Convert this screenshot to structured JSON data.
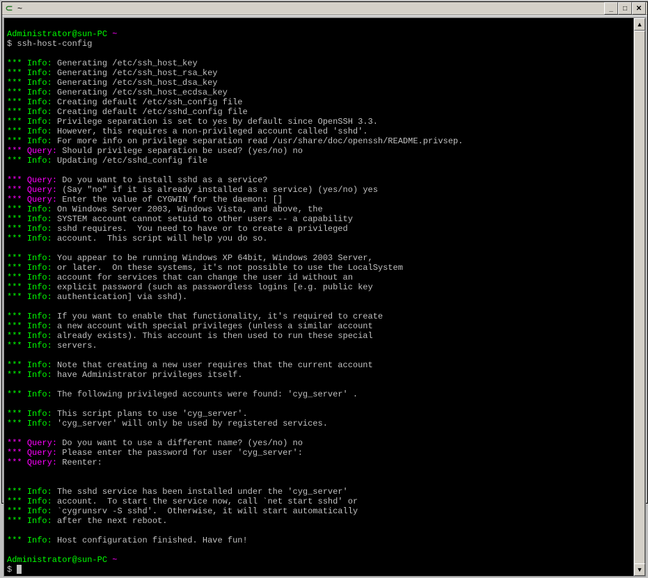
{
  "window": {
    "title": "~"
  },
  "prompt": {
    "user_host": "Administrator@sun-PC",
    "path": "~",
    "symbol": "$"
  },
  "command": "ssh-host-config",
  "stars": "***",
  "labels": {
    "info": "Info:",
    "query": "Query:"
  },
  "lines": [
    "Generating /etc/ssh_host_key",
    "Generating /etc/ssh_host_rsa_key",
    "Generating /etc/ssh_host_dsa_key",
    "Generating /etc/ssh_host_ecdsa_key",
    "Creating default /etc/ssh_config file",
    "Creating default /etc/sshd_config file",
    "Privilege separation is set to yes by default since OpenSSH 3.3.",
    "However, this requires a non-privileged account called 'sshd'.",
    "For more info on privilege separation read /usr/share/doc/openssh/README.privsep."
  ],
  "q1": {
    "text": "Should privilege separation be used? (yes/no)",
    "ans": "no"
  },
  "l10": "Updating /etc/sshd_config file",
  "q2": {
    "text": "Do you want to install sshd as a service?"
  },
  "q3": {
    "text": "(Say \"no\" if it is already installed as a service) (yes/no)",
    "ans": "yes"
  },
  "q4": {
    "text": "Enter the value of CYGWIN for the daemon: []"
  },
  "block2": [
    "On Windows Server 2003, Windows Vista, and above, the",
    "SYSTEM account cannot setuid to other users -- a capability",
    "sshd requires.  You need to have or to create a privileged",
    "account.  This script will help you do so."
  ],
  "block3": [
    "You appear to be running Windows XP 64bit, Windows 2003 Server,",
    "or later.  On these systems, it's not possible to use the LocalSystem",
    "account for services that can change the user id without an",
    "explicit password (such as passwordless logins [e.g. public key",
    "authentication] via sshd)."
  ],
  "block4": [
    "If you want to enable that functionality, it's required to create",
    "a new account with special privileges (unless a similar account",
    "already exists). This account is then used to run these special",
    "servers."
  ],
  "block5": [
    "Note that creating a new user requires that the current account",
    "have Administrator privileges itself."
  ],
  "l_found": "The following privileged accounts were found: 'cyg_server' .",
  "block6": [
    "This script plans to use 'cyg_server'.",
    "'cyg_server' will only be used by registered services."
  ],
  "q5": {
    "text": "Do you want to use a different name? (yes/no)",
    "ans": "no"
  },
  "q6": {
    "text": "Please enter the password for user 'cyg_server':"
  },
  "q7": {
    "text": "Reenter:"
  },
  "block7": [
    "The sshd service has been installed under the 'cyg_server'",
    "account.  To start the service now, call `net start sshd' or",
    "`cygrunsrv -S sshd'.  Otherwise, it will start automatically",
    "after the next reboot."
  ],
  "l_done": "Host configuration finished. Have fun!"
}
